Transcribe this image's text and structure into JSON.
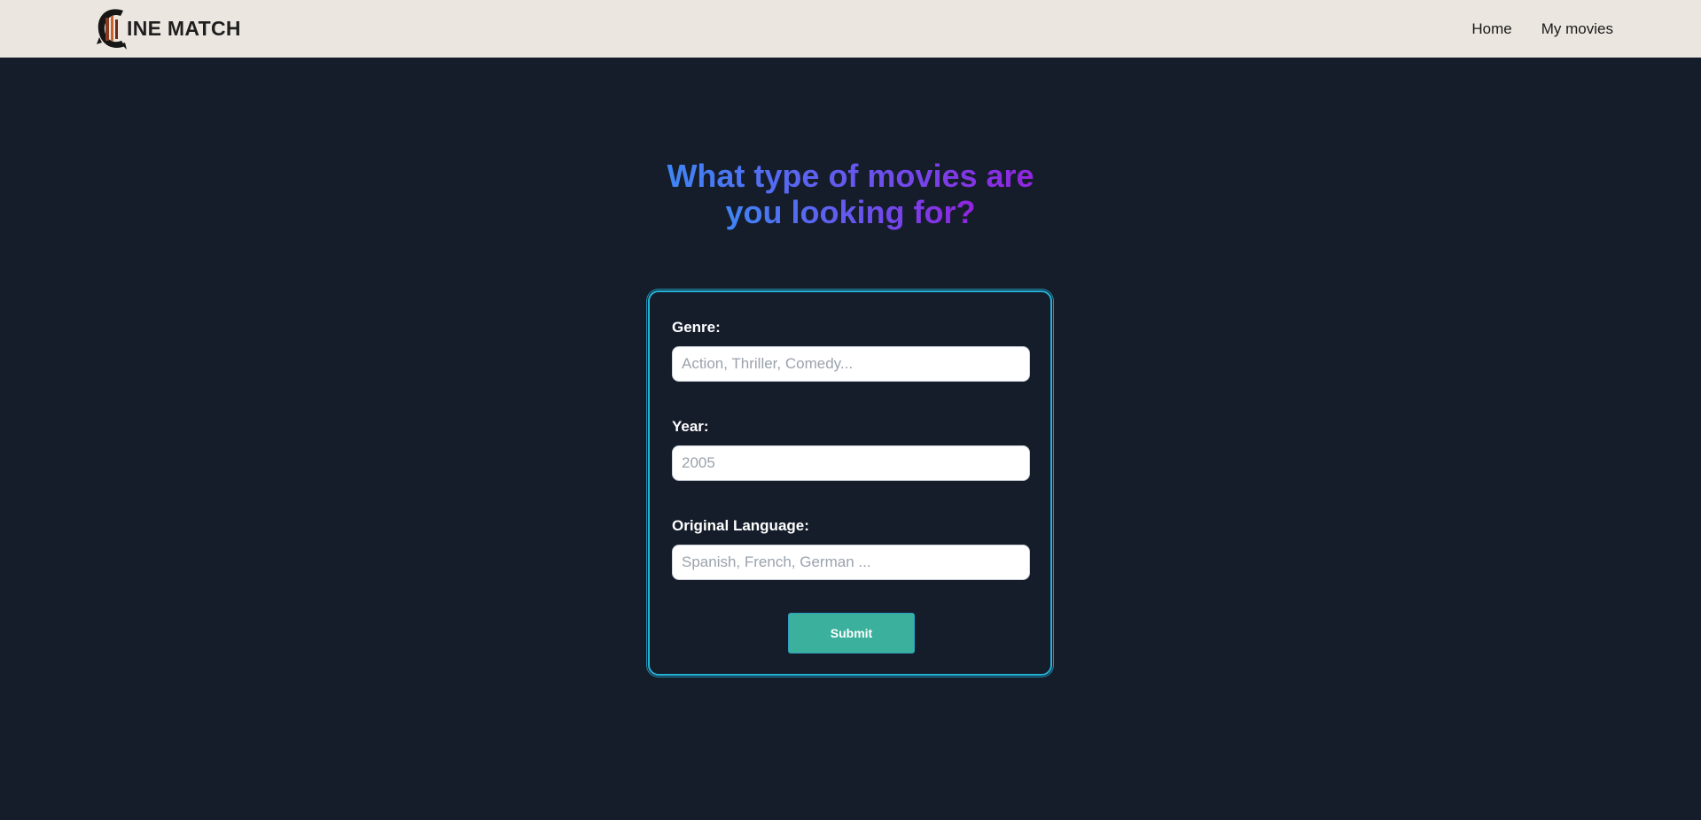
{
  "navbar": {
    "brand": "INE MATCH",
    "links": [
      {
        "label": "Home"
      },
      {
        "label": "My movies"
      }
    ]
  },
  "heading": {
    "line1": "What type of movies are",
    "line2": "you looking for?"
  },
  "form": {
    "genre": {
      "label": "Genre:",
      "placeholder": "Action, Thriller, Comedy..."
    },
    "year": {
      "label": "Year:",
      "placeholder": "2005"
    },
    "language": {
      "label": "Original Language:",
      "placeholder": "Spanish, French, German ..."
    },
    "submit_label": "Submit"
  },
  "colors": {
    "background": "#151c2a",
    "navbar": "#ebe6e0",
    "card_border": "#22b3d6",
    "submit": "#3bb09c",
    "gradient_start": "#3e86f5",
    "gradient_end": "#9124e0"
  },
  "icons": {
    "logo": "film-reel-c-logo-icon"
  }
}
